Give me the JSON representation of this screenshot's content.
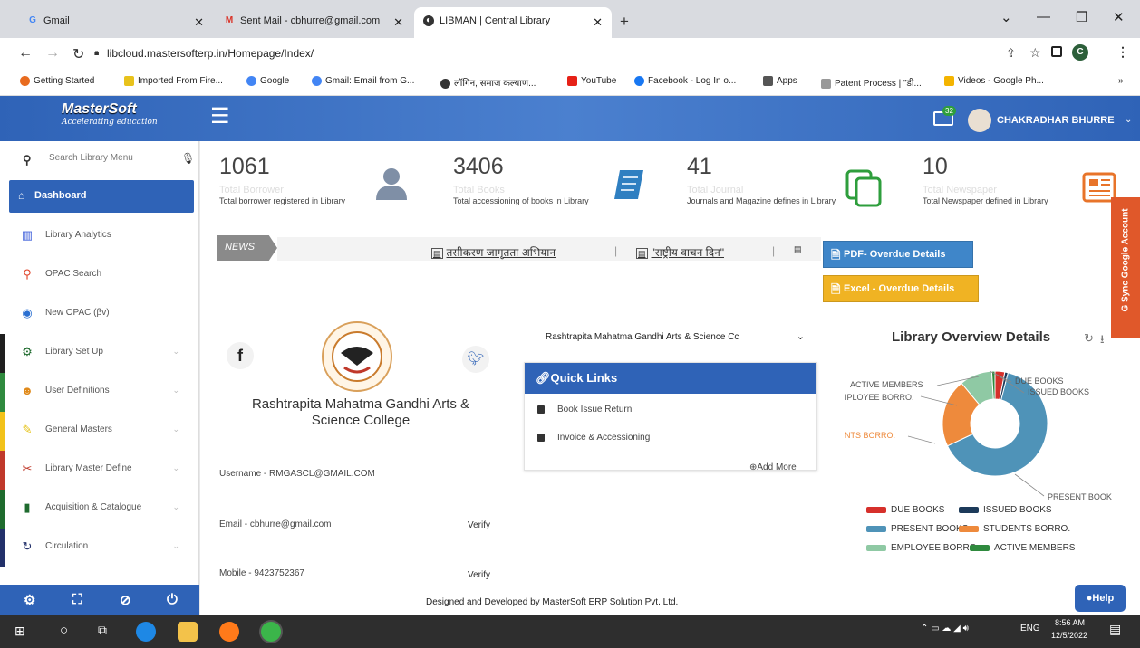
{
  "browser": {
    "tabs": [
      {
        "label": "Gmail",
        "icon": "google-icon"
      },
      {
        "label": "Sent Mail - cbhurre@gmail.com",
        "icon": "gmail-icon"
      },
      {
        "label": "LIBMAN | Central Library",
        "icon": "libman-icon"
      }
    ],
    "new_tab": "+",
    "url": "libcloud.mastersofterp.in/Homepage/Index/",
    "bookmarks": [
      "Getting Started",
      "Imported From Fire...",
      "Google",
      "Gmail: Email from G...",
      "लॉगिन, समाज कल्याण...",
      "YouTube",
      "Facebook - Log In o...",
      "Apps",
      "Patent Process | \"डी...",
      "Videos - Google Ph..."
    ],
    "bookmark_more": "»"
  },
  "app": {
    "logo_title": "MasterSoft",
    "logo_tag": "Accelerating education",
    "menu_icon": "hamburger-icon",
    "mail_badge": "32",
    "user_name": "CHAKRADHAR BHURRE"
  },
  "sidebar": {
    "search_placeholder": "Search Library Menu",
    "dashboard": "Dashboard",
    "items": [
      {
        "label": "Library Analytics",
        "icon": "bar-chart-icon",
        "color": "#3a5bd9"
      },
      {
        "label": "OPAC Search",
        "icon": "search-icon",
        "color": "#e0452b"
      },
      {
        "label": "New OPAC (βv)",
        "icon": "globe-icon",
        "color": "#2a6fd1"
      },
      {
        "label": "Library Set Up",
        "icon": "gears-icon",
        "color": "#1f6b2e"
      },
      {
        "label": "User Definitions",
        "icon": "users-icon",
        "color": "#e08a1b"
      },
      {
        "label": "General Masters",
        "icon": "edit-icon",
        "color": "#e6c317"
      },
      {
        "label": "Library Master Define",
        "icon": "tools-icon",
        "color": "#c0392b"
      },
      {
        "label": "Acquisition & Catalogue",
        "icon": "book-icon",
        "color": "#1f6b2e"
      },
      {
        "label": "Circulation",
        "icon": "refresh-icon",
        "color": "#22306a"
      }
    ]
  },
  "stats": [
    {
      "value": "1061",
      "label": "Total Borrower",
      "desc": "Total borrower registered in Library",
      "icon": "user-icon",
      "color": "#7f8fa6"
    },
    {
      "value": "3406",
      "label": "Total Books",
      "desc": "Total accessioning of books in Library",
      "icon": "book-icon",
      "color": "#2f7fc1"
    },
    {
      "value": "41",
      "label": "Total Journal",
      "desc": "Journals and Magazine defines in Library",
      "icon": "copy-icon",
      "color": "#2e9e3c"
    },
    {
      "value": "10",
      "label": "Total Newspaper",
      "desc": "Total Newspaper defined in Library",
      "icon": "newspaper-icon",
      "color": "#e8742a"
    }
  ],
  "news": {
    "label": "NEWS",
    "items": [
      "तसीकरण जागृतता अभियान",
      "\"राष्ट्रीय वाचन दिन\""
    ],
    "separator": "|"
  },
  "buttons": {
    "pdf": "PDF- Overdue Details",
    "excel": "Excel - Overdue Details",
    "sync": "Sync Google Account",
    "help": "Help"
  },
  "college": {
    "name_line1": "Rashtrapita Mahatma Gandhi Arts &",
    "name_line2": "Science College",
    "select": "Rashtrapita Mahatma Gandhi Arts & Science Cc",
    "username_label": "Username - RMGASCL@GMAIL.COM",
    "email_label": "Email - cbhurre@gmail.com",
    "mobile_label": "Mobile - 9423752367",
    "verify": "Verify"
  },
  "quick_links": {
    "title": "Quick Links",
    "items": [
      "Book Issue Return",
      "Invoice & Accessioning"
    ],
    "add_more": "Add More"
  },
  "footer": "Designed and Developed by MasterSoft ERP Solution Pvt. Ltd.",
  "overview": {
    "title": "Library Overview Details"
  },
  "chart_data": {
    "type": "pie",
    "title": "Library Overview Details",
    "categories": [
      "DUE BOOKS",
      "ISSUED BOOKS",
      "PRESENT BOOKS",
      "STUDENTS BORRO.",
      "EMPLOYEE BORRO.",
      "ACTIVE MEMBERS"
    ],
    "values": [
      3,
      1,
      64,
      21,
      10,
      1
    ],
    "colors": [
      "#d6302b",
      "#1c3a5a",
      "#4f93b8",
      "#ee8a3c",
      "#8fc9a4",
      "#2f8a3e"
    ],
    "slice_labels": [
      "DUE BOOKS",
      "ISSUED BOOKS",
      "PRESENT BOOK",
      "NTS BORRO.",
      "IPLOYEE BORRO.",
      "ACTIVE MEMBERS"
    ],
    "legend_position": "bottom"
  },
  "taskbar": {
    "lang": "ENG",
    "time": "8:56 AM",
    "date": "12/5/2022"
  }
}
